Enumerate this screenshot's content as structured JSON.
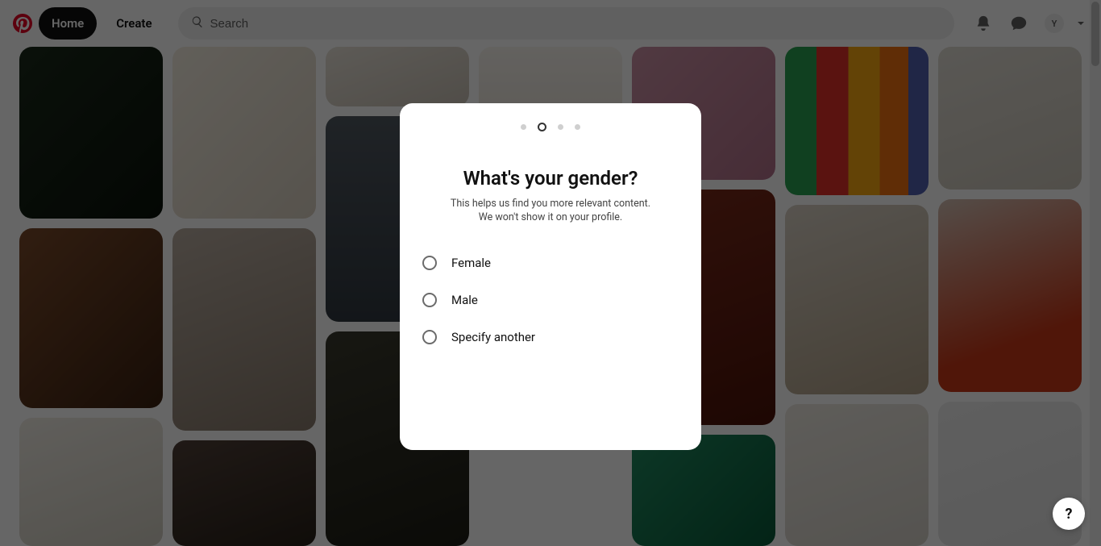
{
  "header": {
    "home_label": "Home",
    "create_label": "Create",
    "search_placeholder": "Search",
    "avatar_initial": "Y"
  },
  "modal": {
    "title": "What's your gender?",
    "subtitle": "This helps us find you more relevant content. We won't show it on your profile.",
    "options": {
      "female": "Female",
      "male": "Male",
      "other": "Specify another"
    },
    "step_total": 4,
    "step_current": 2
  },
  "fab": {
    "label": "?"
  }
}
